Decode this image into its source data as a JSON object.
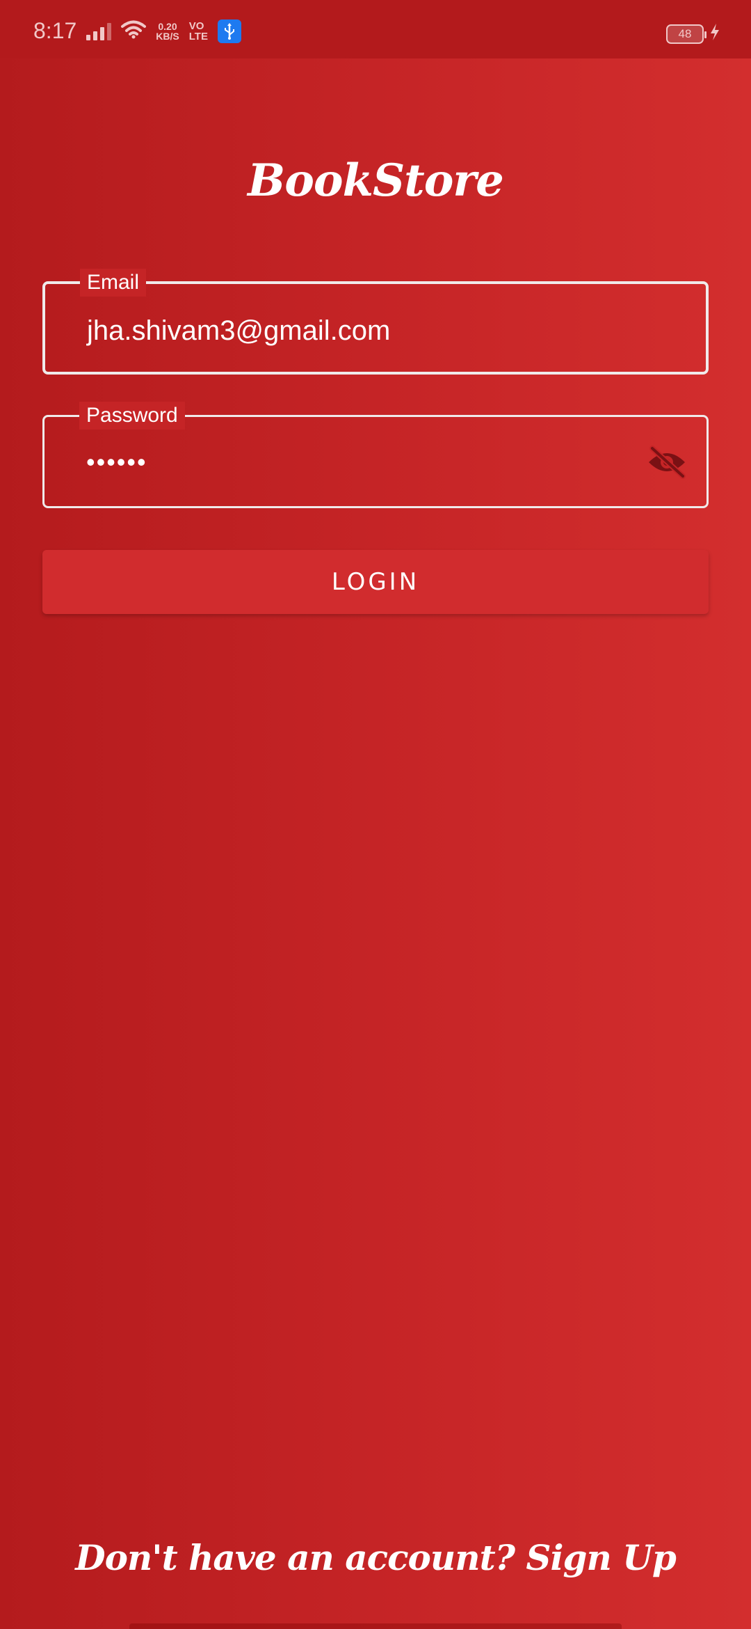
{
  "status_bar": {
    "time": "8:17",
    "net_speed_value": "0.20",
    "net_speed_unit": "KB/S",
    "volte_top": "VO",
    "volte_bottom": "LTE",
    "battery_level": "48",
    "icons": [
      "signal-icon",
      "wifi-icon",
      "usb-icon",
      "battery-icon",
      "charging-icon"
    ]
  },
  "app": {
    "title": "BookStore"
  },
  "form": {
    "email_label": "Email",
    "email_value": "jha.shivam3@gmail.com",
    "password_label": "Password",
    "password_value": "••••••",
    "login_label": "LOGIN"
  },
  "footer": {
    "signup_text": "Don't have an account? Sign Up"
  },
  "colors": {
    "background_start": "#b41b1d",
    "background_end": "#d32e2e",
    "button": "#d12c2e",
    "text": "#ffffff"
  }
}
